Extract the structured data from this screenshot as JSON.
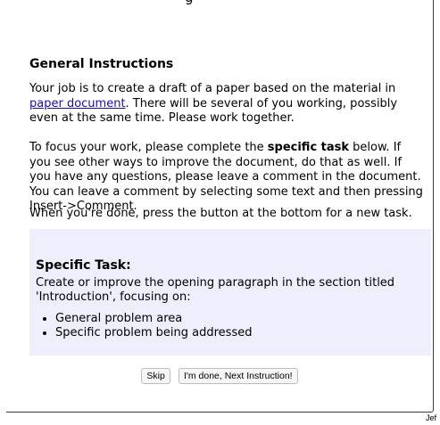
{
  "header": {
    "title_fragment": "g"
  },
  "instructions": {
    "heading": "General Instructions",
    "p1_before_link": "Your job is to create a draft of a paper based on the material in ",
    "p1_link": "paper document",
    "p1_after_link": ". There will be several of you working, possibly even at the same time. Please work together.",
    "p2_before_bold": "To focus your work, please complete the ",
    "p2_bold": "specific task",
    "p2_after_bold": " below. If you see other ways to improve the document, do that as well. If you have any questions, please leave a comment in the document. You can leave a comment by selecting some text and then pressing Insert->Comment.",
    "p3": "When you're done, press the button at the bottom for a new task."
  },
  "task": {
    "heading": "Specific Task:",
    "description": "Create or improve the opening paragraph in the section titled 'Introduction', focusing on:",
    "items": [
      "General problem area",
      "Specific problem being addressed"
    ]
  },
  "buttons": {
    "skip": "Skip",
    "next": "I'm done, Next Instruction!"
  },
  "footer": {
    "text": "Jef"
  }
}
